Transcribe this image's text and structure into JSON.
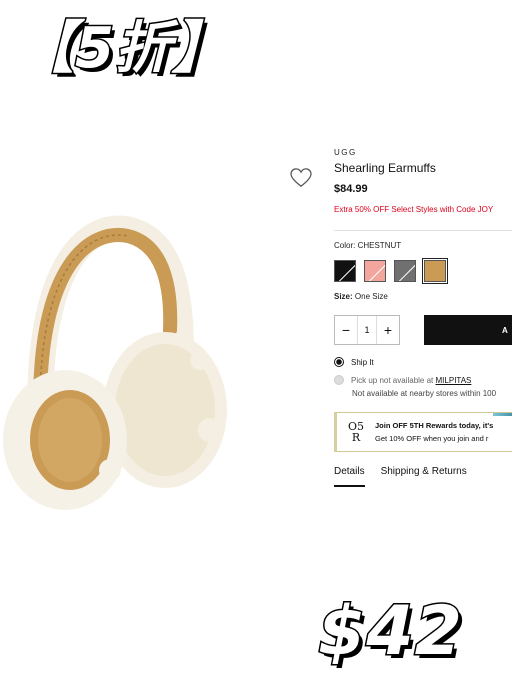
{
  "overlay": {
    "discount_text": "【5折】",
    "sale_price": "$42"
  },
  "product": {
    "brand": "UGG",
    "name": "Shearling Earmuffs",
    "price": "$84.99",
    "promo": "Extra 50% OFF Select Styles with Code JOY",
    "color_label": "Color:",
    "color_value": "CHESTNUT",
    "swatches": [
      {
        "name": "black",
        "color": "#111111"
      },
      {
        "name": "pink",
        "color": "#f3a69d"
      },
      {
        "name": "grey",
        "color": "#707070"
      },
      {
        "name": "chestnut",
        "color": "#c99b55"
      }
    ],
    "size_label": "Size:",
    "size_value": "One Size"
  },
  "purchase": {
    "quantity": "1",
    "minus_symbol": "−",
    "plus_symbol": "+",
    "add_to_bag_label": "A"
  },
  "fulfillment": {
    "ship_label": "Ship It",
    "pickup_text": "Pick up not available at",
    "pickup_store": "MILPITAS",
    "nearby_note": "Not available at nearby stores within 100"
  },
  "rewards": {
    "logo_line1": "O5",
    "logo_line2": "R",
    "headline": "Join OFF 5TH Rewards today, it's",
    "subline": "Get 10% OFF when you join and r"
  },
  "tabs": [
    {
      "label": "Details"
    },
    {
      "label": "Shipping & Returns"
    }
  ],
  "icons": {
    "wishlist": "heart-outline-icon"
  }
}
